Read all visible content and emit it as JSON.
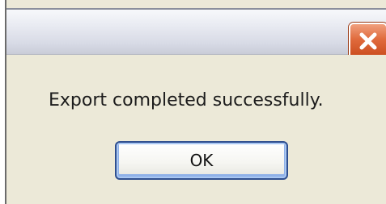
{
  "dialog": {
    "message": "Export completed successfully.",
    "ok_label": "OK"
  },
  "titlebar": {
    "close_icon": "close-icon"
  },
  "colors": {
    "window_background": "#ece9d8",
    "close_button": "#e06a3c",
    "ok_button_border": "#2f4f8f"
  }
}
